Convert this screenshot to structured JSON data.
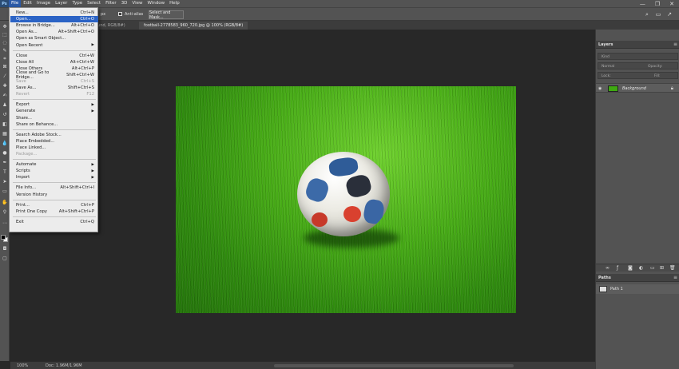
{
  "app": {
    "logo": "Ps"
  },
  "menubar": {
    "items": [
      "File",
      "Edit",
      "Image",
      "Layer",
      "Type",
      "Select",
      "Filter",
      "3D",
      "View",
      "Window",
      "Help"
    ],
    "window_controls": {
      "minimize": "—",
      "restore": "❐",
      "close": "✕"
    }
  },
  "options": {
    "style_fragment": "px",
    "antialias_label": "Anti-alias",
    "select_mask_label": "Select and Mask..."
  },
  "tabs": [
    {
      "label": "ground, RGB/8#)",
      "active": false
    },
    {
      "label": "football-2778583_960_720.jpg @ 100% (RGB/8#)",
      "active": true
    }
  ],
  "file_menu": {
    "items": [
      {
        "label": "New...",
        "shortcut": "Ctrl+N",
        "highlight": false,
        "disabled": false,
        "submenu": false
      },
      {
        "label": "Open...",
        "shortcut": "Ctrl+O",
        "highlight": true,
        "disabled": false,
        "submenu": false
      },
      {
        "label": "Browse in Bridge...",
        "shortcut": "Alt+Ctrl+O",
        "highlight": false,
        "disabled": false,
        "submenu": false
      },
      {
        "label": "Open As...",
        "shortcut": "Alt+Shift+Ctrl+O",
        "highlight": false,
        "disabled": false,
        "submenu": false
      },
      {
        "label": "Open as Smart Object...",
        "shortcut": "",
        "highlight": false,
        "disabled": false,
        "submenu": false
      },
      {
        "label": "Open Recent",
        "shortcut": "",
        "highlight": false,
        "disabled": false,
        "submenu": true
      },
      {
        "label": "Close",
        "shortcut": "Ctrl+W",
        "highlight": false,
        "disabled": false,
        "submenu": false
      },
      {
        "label": "Close All",
        "shortcut": "Alt+Ctrl+W",
        "highlight": false,
        "disabled": false,
        "submenu": false
      },
      {
        "label": "Close Others",
        "shortcut": "Alt+Ctrl+P",
        "highlight": false,
        "disabled": false,
        "submenu": false
      },
      {
        "label": "Close and Go to Bridge...",
        "shortcut": "Shift+Ctrl+W",
        "highlight": false,
        "disabled": false,
        "submenu": false
      },
      {
        "label": "Save",
        "shortcut": "Ctrl+S",
        "highlight": false,
        "disabled": true,
        "submenu": false
      },
      {
        "label": "Save As...",
        "shortcut": "Shift+Ctrl+S",
        "highlight": false,
        "disabled": false,
        "submenu": false
      },
      {
        "label": "Revert",
        "shortcut": "F12",
        "highlight": false,
        "disabled": true,
        "submenu": false
      },
      {
        "label": "Export",
        "shortcut": "",
        "highlight": false,
        "disabled": false,
        "submenu": true
      },
      {
        "label": "Generate",
        "shortcut": "",
        "highlight": false,
        "disabled": false,
        "submenu": true
      },
      {
        "label": "Share...",
        "shortcut": "",
        "highlight": false,
        "disabled": false,
        "submenu": false
      },
      {
        "label": "Share on Behance...",
        "shortcut": "",
        "highlight": false,
        "disabled": false,
        "submenu": false
      },
      {
        "label": "Search Adobe Stock...",
        "shortcut": "",
        "highlight": false,
        "disabled": false,
        "submenu": false
      },
      {
        "label": "Place Embedded...",
        "shortcut": "",
        "highlight": false,
        "disabled": false,
        "submenu": false
      },
      {
        "label": "Place Linked...",
        "shortcut": "",
        "highlight": false,
        "disabled": false,
        "submenu": false
      },
      {
        "label": "Package...",
        "shortcut": "",
        "highlight": false,
        "disabled": true,
        "submenu": false
      },
      {
        "label": "Automate",
        "shortcut": "",
        "highlight": false,
        "disabled": false,
        "submenu": true
      },
      {
        "label": "Scripts",
        "shortcut": "",
        "highlight": false,
        "disabled": false,
        "submenu": true
      },
      {
        "label": "Import",
        "shortcut": "",
        "highlight": false,
        "disabled": false,
        "submenu": true
      },
      {
        "label": "File Info...",
        "shortcut": "Alt+Shift+Ctrl+I",
        "highlight": false,
        "disabled": false,
        "submenu": false
      },
      {
        "label": "Version History",
        "shortcut": "",
        "highlight": false,
        "disabled": false,
        "submenu": false
      },
      {
        "label": "Print...",
        "shortcut": "Ctrl+P",
        "highlight": false,
        "disabled": false,
        "submenu": false
      },
      {
        "label": "Print One Copy",
        "shortcut": "Alt+Shift+Ctrl+P",
        "highlight": false,
        "disabled": false,
        "submenu": false
      },
      {
        "label": "Exit",
        "shortcut": "Ctrl+Q",
        "highlight": false,
        "disabled": false,
        "submenu": false
      }
    ],
    "submenu_arrow": "▶"
  },
  "layers_panel": {
    "title": "Layers",
    "search_placeholder": "Kind",
    "blend_mode": "Normal",
    "opacity_label": "Opacity:",
    "lock_label": "Lock:",
    "fill_label": "Fill:",
    "layer_name": "Background"
  },
  "paths_panel": {
    "title": "Paths",
    "path_name": "Path 1"
  },
  "status": {
    "zoom": "100%",
    "doc": "Doc: 1.96M/1.96M"
  },
  "colors": {
    "menu_highlight": "#2b63c5",
    "ui_panel": "#535353",
    "canvas_bg": "#282828",
    "grass": "#47ac16"
  }
}
